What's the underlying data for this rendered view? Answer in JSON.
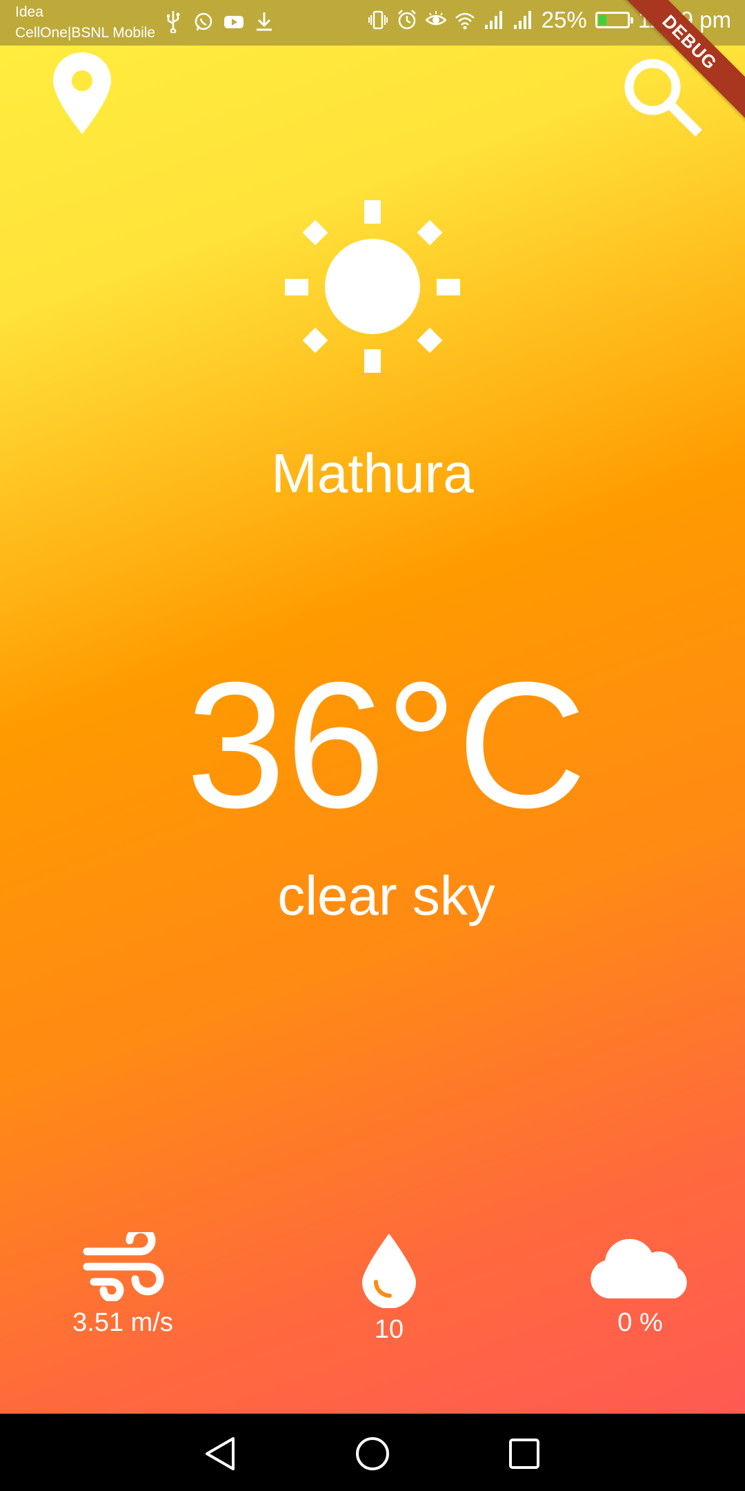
{
  "status_bar": {
    "carrier_primary": "Idea",
    "carrier_secondary": "CellOne|BSNL Mobile",
    "battery_percent": "25%",
    "time": "11:09 pm",
    "battery_level": 0.25,
    "left_icons": [
      "usb-icon",
      "whatsapp-icon",
      "youtube-icon",
      "download-icon"
    ],
    "right_icons": [
      "vibrate-icon",
      "alarm-icon",
      "eye-icon",
      "wifi-icon",
      "signal-icon",
      "signal-icon",
      "battery-charging-icon"
    ]
  },
  "debug_banner": "DEBUG",
  "actions": {
    "location_icon": "location-pin-icon",
    "search_icon": "search-icon"
  },
  "weather": {
    "icon": "sun-icon",
    "city": "Mathura",
    "temperature": "36°C",
    "condition": "clear sky"
  },
  "stats": {
    "wind": {
      "icon": "wind-icon",
      "value": "3.51 m/s"
    },
    "humidity": {
      "icon": "water-drop-icon",
      "value": "10"
    },
    "cloudiness": {
      "icon": "cloud-icon",
      "value": "0 %"
    }
  },
  "nav": {
    "back_icon": "back-triangle-icon",
    "home_icon": "home-circle-icon",
    "recent_icon": "recent-square-icon"
  },
  "colors": {
    "gradient_top": "#ffee3e",
    "gradient_mid": "#ff9a00",
    "gradient_bottom": "#ff555a",
    "status_bar": "#bdaa3a",
    "debug_ribbon": "#a9371f",
    "text": "#ffffff"
  }
}
